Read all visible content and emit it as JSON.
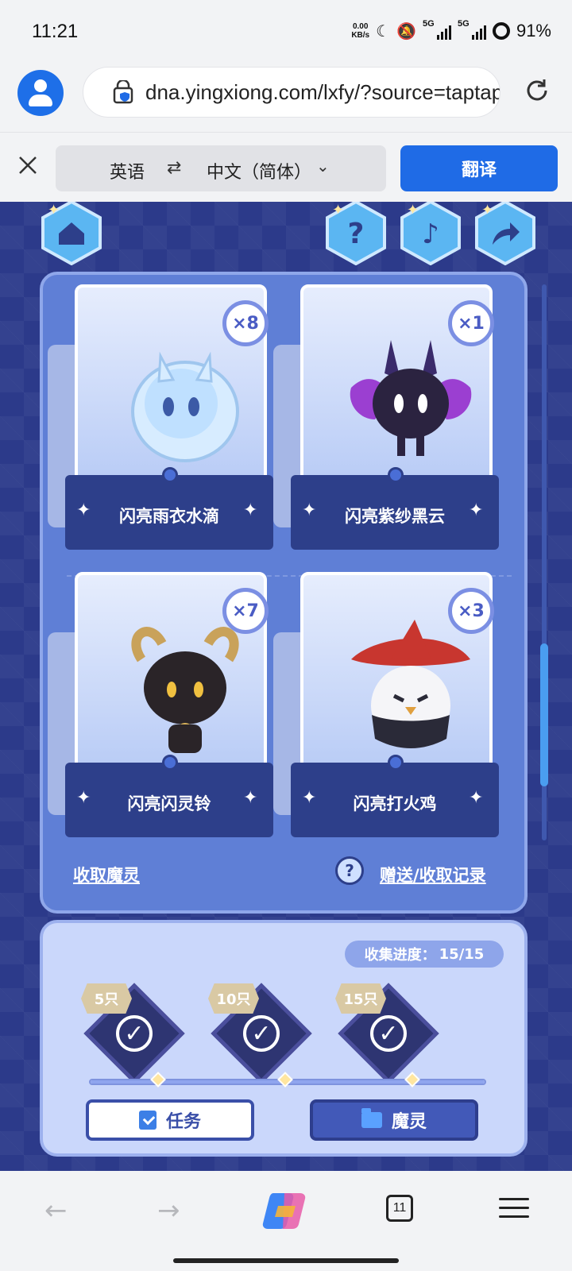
{
  "status_bar": {
    "time": "11:21",
    "net_speed_value": "0.00",
    "net_speed_unit": "KB/s",
    "signal1_label": "5G",
    "signal2_label": "5G",
    "battery": "91%"
  },
  "browser": {
    "url": "dna.yingxiong.com/lxfy/?source=taptap",
    "tabs_count": "11"
  },
  "translate_bar": {
    "source_lang": "英语",
    "swap_symbol": "⇄",
    "target_lang": "中文（简体）",
    "translate_button": "翻译"
  },
  "game": {
    "cards": [
      {
        "name": "闪亮雨衣水滴",
        "count": "×8",
        "color": "#bfe0ff"
      },
      {
        "name": "闪亮紫纱黑云",
        "count": "×1",
        "color": "#2b2340"
      },
      {
        "name": "闪亮闪灵铃",
        "count": "×7",
        "color": "#2a2428"
      },
      {
        "name": "闪亮打火鸡",
        "count": "×3",
        "color": "#c8362f"
      }
    ],
    "collect_link": "收取魔灵",
    "help_symbol": "?",
    "record_link": "赠送/收取记录",
    "progress_label": "收集进度：",
    "progress_value": "15/15",
    "progress_fraction": 1.0,
    "milestones": [
      {
        "label": "5只",
        "completed": true
      },
      {
        "label": "10只",
        "completed": true
      },
      {
        "label": "15只",
        "completed": true
      }
    ],
    "check_symbol": "✓",
    "task_button": "任务",
    "pet_button": "魔灵"
  },
  "colors": {
    "accent": "#1f6be6",
    "game_bg": "#2c3a8a",
    "panel": "#5f7fd6"
  }
}
